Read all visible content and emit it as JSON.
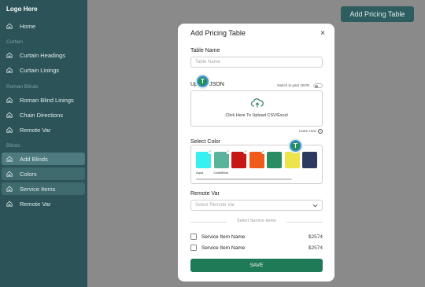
{
  "logo": "Logo Here",
  "sidebar": {
    "items": [
      {
        "label": "Home"
      },
      {
        "label": "Curtain Headings"
      },
      {
        "label": "Curtain Linings"
      },
      {
        "label": "Roman Blind Linings"
      },
      {
        "label": "Chain Directions"
      },
      {
        "label": "Remote Var"
      },
      {
        "label": "Add Blinds"
      },
      {
        "label": "Colors"
      },
      {
        "label": "Service Items"
      },
      {
        "label": "Remote Var"
      }
    ],
    "sections": {
      "curtain": "Curtain",
      "roman": "Roman Blinds",
      "blinds": "Blinds"
    }
  },
  "header": {
    "add_pricing_table": "Add Pricing Table"
  },
  "modal": {
    "title": "Add Pricing Table",
    "close": "×",
    "table_name_label": "Table Name",
    "table_name_placeholder": "Table Name",
    "upload_label": "Upload JSON",
    "switch_label": "Switch to past JSON",
    "dropzone_text": "Click Here To Upload  CSV/Excel",
    "learn_how": "Learn How",
    "select_color_label": "Select Color",
    "colors": [
      {
        "hex": "#36f0f2",
        "label": "Aqua",
        "checked": true
      },
      {
        "hex": "#5ab39b",
        "label": "CadetBlue",
        "checked": true
      },
      {
        "hex": "#c71616",
        "label": "",
        "checked": true
      },
      {
        "hex": "#f05a1a",
        "label": "",
        "checked": true
      },
      {
        "hex": "#2a8c62",
        "label": "",
        "checked": false
      },
      {
        "hex": "#ece44a",
        "label": "",
        "checked": false
      },
      {
        "hex": "#2b3a5e",
        "label": "",
        "checked": false
      }
    ],
    "remote_var_label": "Remote Var",
    "remote_var_placeholder": "Select Remote Var",
    "service_items_divider": "Select Service Items",
    "service_items": [
      {
        "name": "Service Item Name",
        "price": "$2574"
      },
      {
        "name": "Service Item Name",
        "price": "$2574"
      }
    ],
    "save": "SAVE"
  },
  "avatars": {
    "letter1": "T",
    "letter2": "T",
    "color": "#1d8f5a"
  }
}
